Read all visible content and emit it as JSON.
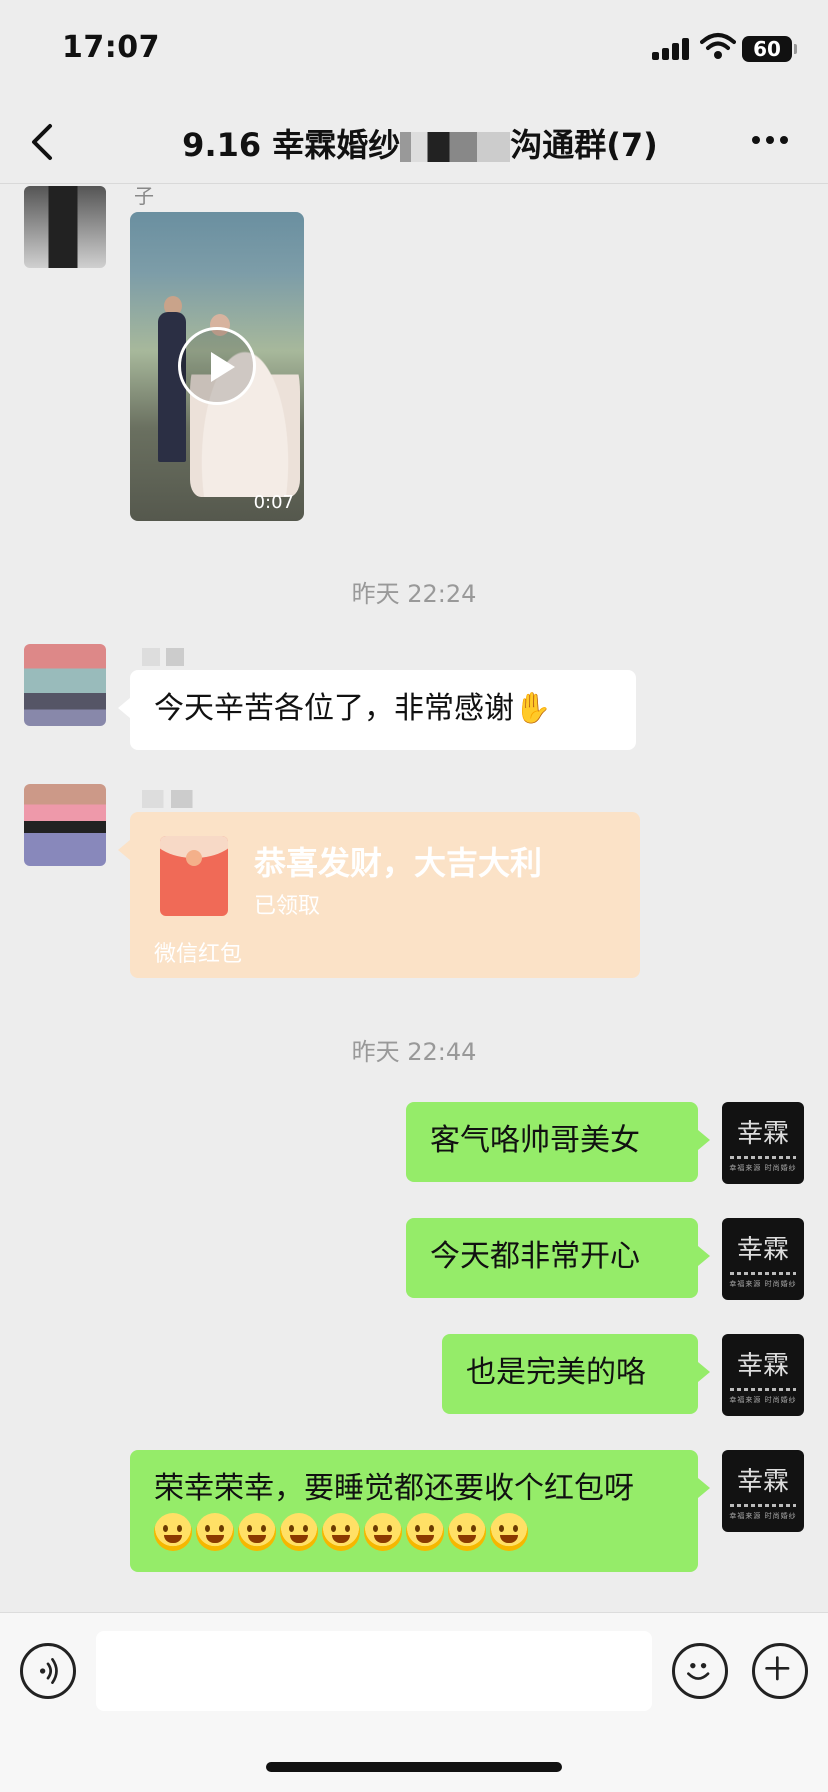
{
  "status_bar": {
    "time": "17:07",
    "battery": "60"
  },
  "nav": {
    "title_prefix": "9.16 幸霖婚纱",
    "title_suffix": "沟通群(7)",
    "back_icon": "chevron-left-icon",
    "more_icon": "more-dots-icon"
  },
  "messages": {
    "video": {
      "sender_name": "子",
      "duration": "0:07"
    },
    "timestamp_1": "昨天 22:24",
    "msg_thanks": "今天辛苦各位了，非常感谢",
    "redpacket": {
      "title": "恭喜发财，大吉大利",
      "status": "已领取",
      "footer": "微信红包"
    },
    "timestamp_2": "昨天 22:44",
    "my_avatar": {
      "text": "幸霖",
      "sub": "幸福来源 时尚婚纱"
    },
    "reply_1": "客气咯帅哥美女",
    "reply_2": "今天都非常开心",
    "reply_3": "也是完美的咯",
    "reply_4": "荣幸荣幸，要睡觉都还要收个红包呀"
  },
  "input_bar": {
    "voice_icon": "voice-icon",
    "emoji_icon": "emoji-icon",
    "plus_icon": "plus-icon"
  },
  "colors": {
    "background": "#ededed",
    "my_bubble": "#95ec69",
    "their_bubble": "#ffffff",
    "redpacket": "#fbe2c7"
  }
}
